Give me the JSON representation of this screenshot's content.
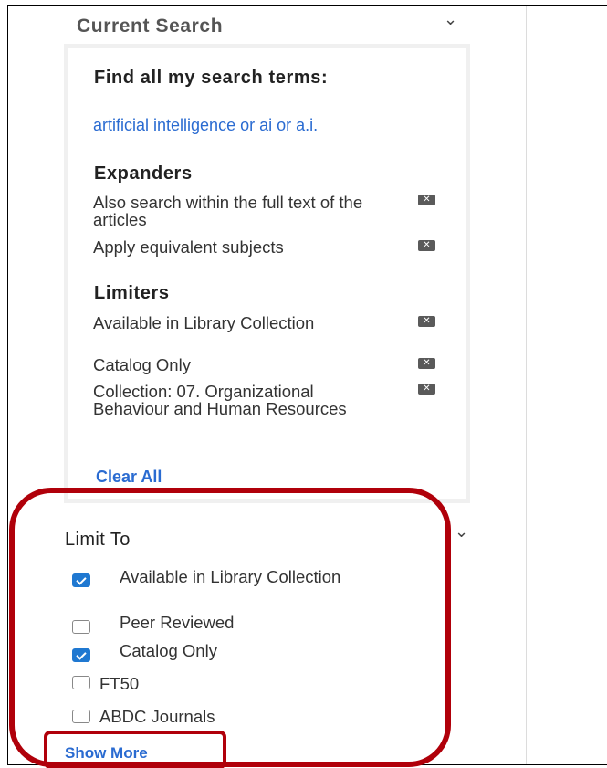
{
  "current_search": {
    "title": "Current Search",
    "find_heading": "Find all my search terms:",
    "search_term": "artificial intelligence or ai or a.i.",
    "expanders_heading": "Expanders",
    "expanders": [
      "Also search within the full text of the articles",
      "Apply equivalent subjects"
    ],
    "limiters_heading": "Limiters",
    "limiters": [
      "Available in Library Collection",
      "Catalog Only",
      "Collection: 07. Organizational Behaviour and Human Resources"
    ],
    "remove_glyph": "✕",
    "clear_all_label": "Clear All"
  },
  "limit_to": {
    "title": "Limit To",
    "options": [
      {
        "label": "Available in Library Collection",
        "checked": true
      },
      {
        "label": "Peer Reviewed",
        "checked": false
      },
      {
        "label": "Catalog Only",
        "checked": true
      },
      {
        "label": "FT50",
        "checked": false
      },
      {
        "label": "ABDC Journals",
        "checked": false
      }
    ],
    "show_more_label": "Show More"
  },
  "icons": {
    "collapse": "chevron-down-icon",
    "remove": "close-icon"
  },
  "colors": {
    "link": "#2a6bd1",
    "checkbox_checked": "#1f78d1",
    "highlight": "#b0000a"
  }
}
